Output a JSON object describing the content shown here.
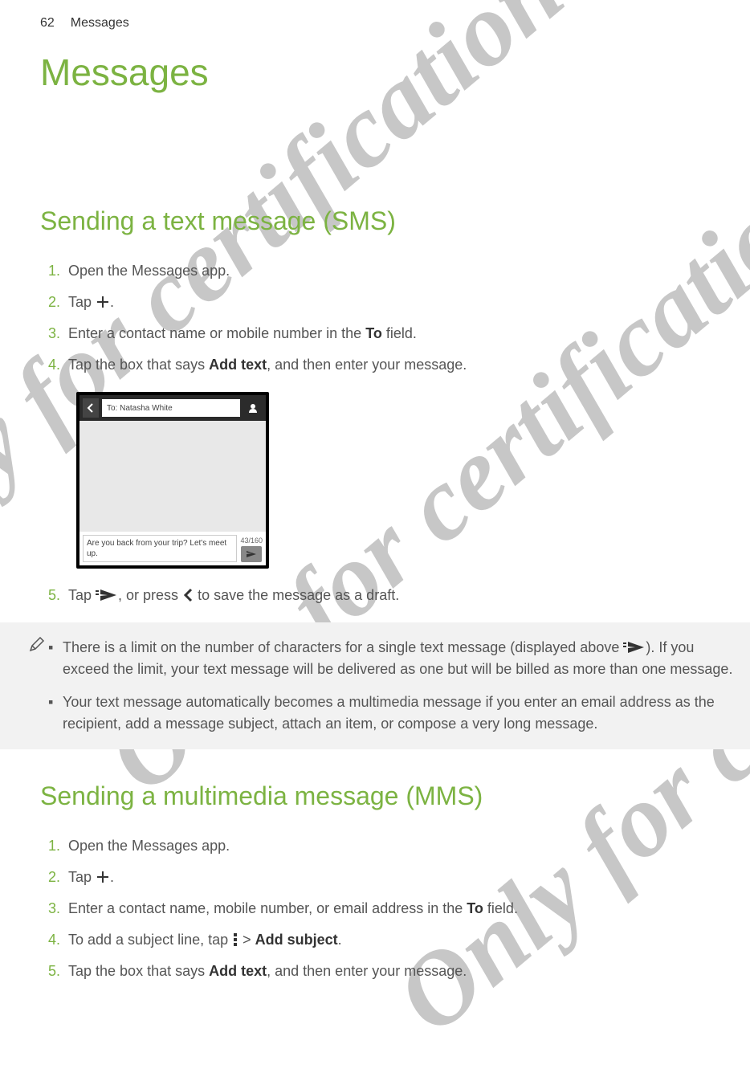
{
  "header": {
    "page_num": "62",
    "section": "Messages"
  },
  "h1": "Messages",
  "watermark": "Only for certification",
  "sms": {
    "heading": "Sending a text message (SMS)",
    "steps": {
      "s1": "Open the Messages app.",
      "s2a": "Tap ",
      "s2b": ".",
      "s3a": "Enter a contact name or mobile number in the ",
      "s3_to": "To",
      "s3b": " field.",
      "s4a": "Tap the box that says ",
      "s4_bold": "Add text",
      "s4b": ", and then enter your message.",
      "s5a": "Tap ",
      "s5b": ", or press ",
      "s5c": " to save the message as a draft."
    },
    "screenshot": {
      "to_placeholder": "To: Natasha White",
      "body_text": "Are you back from your trip? Let's meet up.",
      "char_count": "43/160"
    },
    "notes": {
      "n1a": "There is a limit on the number of characters for a single text message (displayed above ",
      "n1b": "). If you exceed the limit, your text message will be delivered as one but will be billed as more than one message.",
      "n2": "Your text message automatically becomes a multimedia message if you enter an email address as the recipient, add a message subject, attach an item, or compose a very long message."
    }
  },
  "mms": {
    "heading": "Sending a multimedia message (MMS)",
    "steps": {
      "s1": "Open the Messages app.",
      "s2a": "Tap ",
      "s2b": ".",
      "s3a": "Enter a contact name, mobile number, or email address in the ",
      "s3_to": "To",
      "s3b": " field.",
      "s4a": "To add a subject line, tap ",
      "s4b": " > ",
      "s4_bold": "Add subject",
      "s4c": ".",
      "s5a": "Tap the box that says ",
      "s5_bold": "Add text",
      "s5b": ", and then enter your message."
    }
  }
}
